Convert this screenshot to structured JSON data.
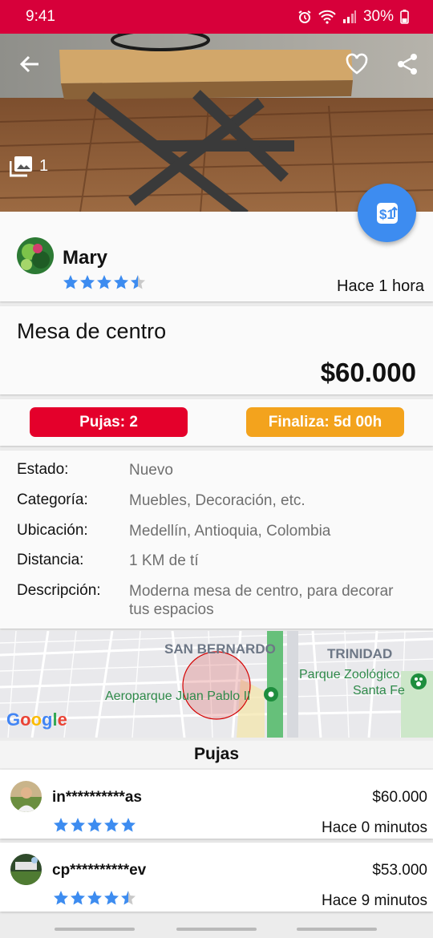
{
  "status_bar": {
    "time": "9:41",
    "battery": "30%"
  },
  "listing": {
    "photo_count": "1",
    "seller": {
      "name": "Mary",
      "rating": 4.5,
      "posted": "Hace 1 hora"
    },
    "title": "Mesa de centro",
    "price": "$60.000",
    "bids_badge": "Pujas: 2",
    "ends_badge": "Finaliza: 5d 00h",
    "details": [
      {
        "label": "Estado:",
        "value": "Nuevo"
      },
      {
        "label": "Categoría:",
        "value": "Muebles, Decoración, etc."
      },
      {
        "label": "Ubicación:",
        "value": "Medellín, Antioquia, Colombia"
      },
      {
        "label": "Distancia:",
        "value": "1 KM de tí"
      },
      {
        "label": "Descripción:",
        "value": "Moderna mesa de centro, para decorar tus espacios"
      }
    ]
  },
  "map": {
    "labels": [
      "SAN BERNARDO",
      "TRINIDAD",
      "Parque Zoológico",
      "Santa Fe",
      "Aeroparque Juan Pablo II"
    ],
    "brand": "Google"
  },
  "bids": {
    "header": "Pujas",
    "items": [
      {
        "user": "in**********as",
        "amount": "$60.000",
        "time": "Hace 0 minutos",
        "rating": 5
      },
      {
        "user": "cp**********ev",
        "amount": "$53.000",
        "time": "Hace 9 minutos",
        "rating": 4.5
      }
    ]
  },
  "colors": {
    "brand_red": "#d7003a",
    "accent_blue": "#3d8cf0",
    "badge_red": "#e4002b",
    "badge_orange": "#f3a31d",
    "star_blue": "#3d8cf0"
  },
  "icons": {
    "back": "back-arrow-icon",
    "favorite": "heart-outline-icon",
    "share": "share-icon",
    "gallery": "image-gallery-icon",
    "bid": "bid-money-icon",
    "star": "star-icon"
  }
}
